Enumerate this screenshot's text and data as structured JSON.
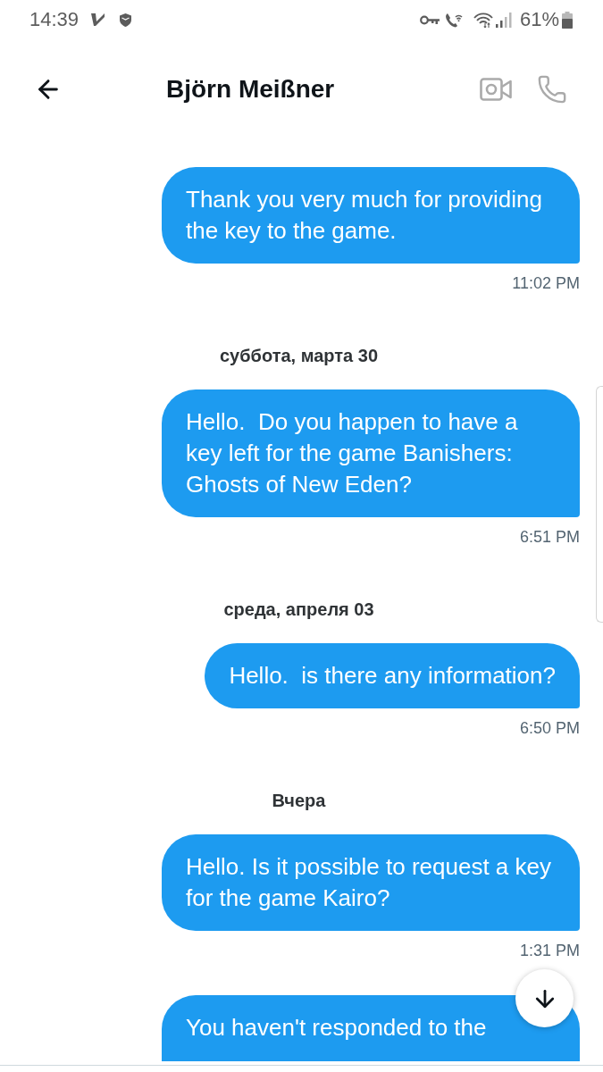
{
  "status_bar": {
    "time": "14:39",
    "battery": "61%"
  },
  "header": {
    "title": "Björn Meißner"
  },
  "messages": [
    {
      "kind": "message",
      "text": "Thank you very much for providing the key to the game.",
      "time": "11:02 PM",
      "truncated": false
    },
    {
      "kind": "date",
      "text": "суббота, марта 30"
    },
    {
      "kind": "message",
      "text": "Hello.  Do you happen to have a key left for the game Banishers: Ghosts of New Eden?",
      "time": "6:51 PM",
      "truncated": false
    },
    {
      "kind": "date",
      "text": "среда, апреля 03"
    },
    {
      "kind": "message",
      "text": "Hello.  is there any information?",
      "time": "6:50 PM",
      "truncated": false
    },
    {
      "kind": "date",
      "text": "Вчера"
    },
    {
      "kind": "message",
      "text": "Hello. Is it possible to request a key for the game Kairo?",
      "time": "1:31 PM",
      "truncated": false
    },
    {
      "kind": "message",
      "text": "You haven't responded to the",
      "truncated": true
    }
  ]
}
